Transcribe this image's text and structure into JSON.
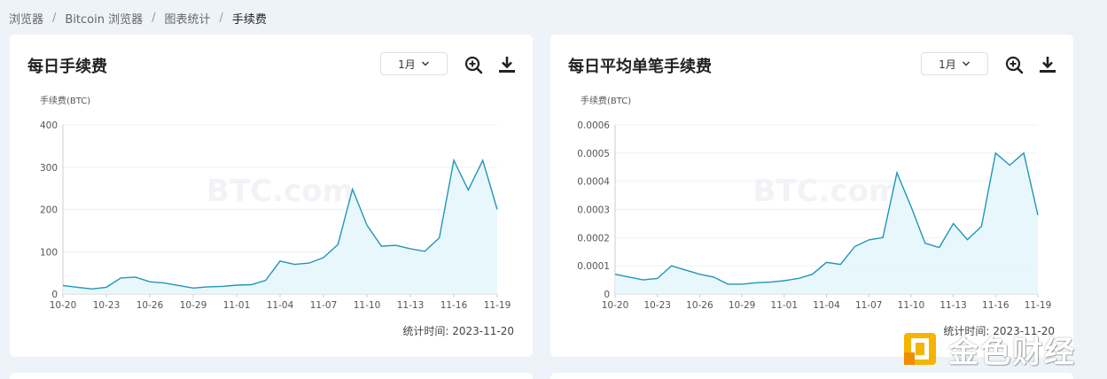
{
  "breadcrumb": [
    "浏览器",
    "Bitcoin 浏览器",
    "图表统计",
    "手续费"
  ],
  "colors": {
    "line": "#2196b8",
    "fill": "#e6f6fb",
    "accent": "#1a9cc4"
  },
  "cards": [
    {
      "title": "每日手续费",
      "period": "1月",
      "icons": [
        "zoom-in-icon",
        "download-icon"
      ],
      "stat_text": "统计时间: 2023-11-20",
      "chart_data": {
        "type": "area",
        "ylabel": "手续费(BTC)",
        "watermark": "BTC.com",
        "ylim": [
          0,
          400
        ],
        "yticks": [
          "0",
          "100",
          "200",
          "300",
          "400"
        ],
        "xticks": [
          "10-20",
          "10-23",
          "10-26",
          "10-29",
          "11-01",
          "11-04",
          "11-07",
          "11-10",
          "11-13",
          "11-16",
          "11-19"
        ],
        "values": [
          20,
          16,
          12,
          16,
          38,
          40,
          29,
          26,
          20,
          14,
          17,
          18,
          21,
          22,
          32,
          78,
          70,
          73,
          86,
          117,
          248,
          163,
          113,
          115,
          107,
          101,
          133,
          316,
          246,
          316,
          200
        ]
      }
    },
    {
      "title": "每日平均单笔手续费",
      "period": "1月",
      "icons": [
        "zoom-in-icon",
        "download-icon"
      ],
      "stat_text": "统计时间: 2023-11-20",
      "chart_data": {
        "type": "area",
        "ylabel": "手续费(BTC)",
        "watermark": "BTC.com",
        "ylim": [
          0,
          0.0006
        ],
        "yticks": [
          "0",
          "0.0001",
          "0.0002",
          "0.0003",
          "0.0004",
          "0.0005",
          "0.0006"
        ],
        "xticks": [
          "10-20",
          "10-23",
          "10-26",
          "10-29",
          "11-01",
          "11-04",
          "11-07",
          "11-10",
          "11-13",
          "11-16",
          "11-19"
        ],
        "values": [
          7e-05,
          6e-05,
          5e-05,
          5.5e-05,
          0.0001,
          8.5e-05,
          7e-05,
          6e-05,
          3.5e-05,
          3.5e-05,
          4e-05,
          4.2e-05,
          4.7e-05,
          5.5e-05,
          7e-05,
          0.000112,
          0.000105,
          0.000168,
          0.000192,
          0.0002,
          0.00043,
          0.00031,
          0.00018,
          0.000165,
          0.00025,
          0.000193,
          0.00024,
          0.0005,
          0.000457,
          0.0005,
          0.00028
        ]
      }
    }
  ],
  "logo": {
    "text": "金色财经"
  }
}
